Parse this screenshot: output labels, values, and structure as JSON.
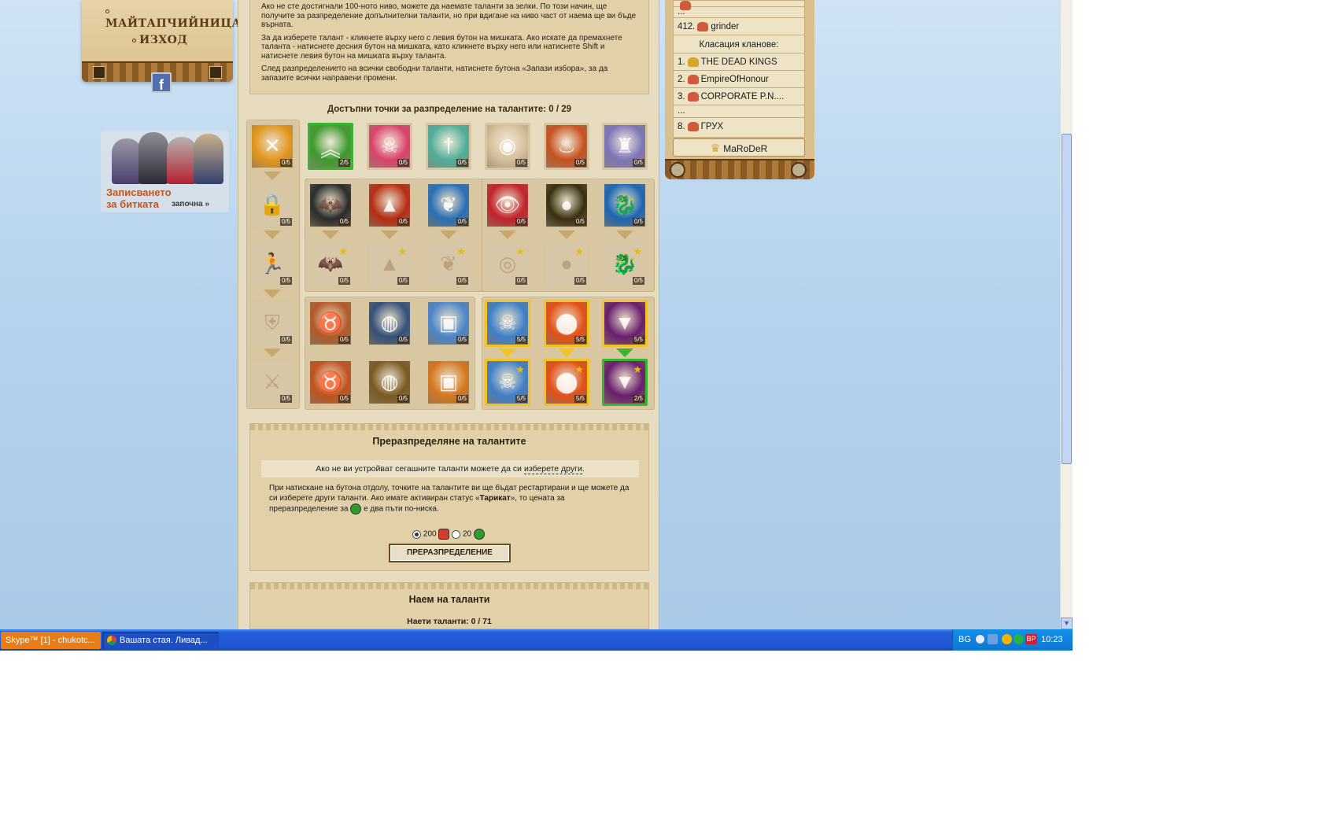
{
  "menu": {
    "item_1": "МАЙТАПЧИЙНИЦА",
    "item_2": "ИЗХОД",
    "facebook_icon": "f"
  },
  "promo": {
    "line_1": "Записването",
    "line_2": "за битката",
    "start": "започна »"
  },
  "info": {
    "p1": "Ако не сте достигнали 100-ното ниво, можете да наемате таланти за зелки. По този начин, ще получите за разпределение допълнителни таланти, но при вдигане на ниво част от наема ще ви бъде върната.",
    "p2": "За да изберете талант - кликнете върху него с левия бутон на мишката. Ако искате да премахнете таланта - натиснете десния бутон на мишката, като кликнете върху него или натиснете Shift и натиснете левия бутон на мишката върху таланта.",
    "p3": "След разпределението на всички свободни таланти, натиснете бутона «Запази избора», за да запазите всички направени промени."
  },
  "points_label": "Достъпни точки за разпределение на талантите: 0 / 29",
  "talents": {
    "row1": [
      {
        "lvl": "0/5",
        "icon": "crossed-swords",
        "color": "#e3961c",
        "glyph": "✕",
        "state": "normal"
      },
      {
        "lvl": "2/5",
        "icon": "rank-chevrons",
        "color": "#3f9a2f",
        "glyph": "︽",
        "state": "green"
      },
      {
        "lvl": "0/5",
        "icon": "skull",
        "color": "#d9436b",
        "glyph": "☠",
        "state": "normal"
      },
      {
        "lvl": "0/5",
        "icon": "sword-scroll",
        "color": "#4fae9a",
        "glyph": "†",
        "state": "normal"
      },
      {
        "lvl": "0/5",
        "icon": "medal-scroll",
        "color": "#d7c09a",
        "glyph": "◉",
        "state": "normal"
      },
      {
        "lvl": "0/5",
        "icon": "flame-sword",
        "color": "#c7521f",
        "glyph": "♨",
        "state": "normal"
      },
      {
        "lvl": "0/5",
        "icon": "knight",
        "color": "#7d74b8",
        "glyph": "♜",
        "state": "normal"
      }
    ],
    "row2": [
      {
        "lvl": "0/5",
        "icon": "padlock",
        "color": "#d7c7a6",
        "glyph": "🔒",
        "state": "locked"
      },
      {
        "lvl": "0/5",
        "icon": "bat",
        "color": "#2b2b2b",
        "glyph": "🦇",
        "state": "normal"
      },
      {
        "lvl": "0/5",
        "icon": "monster-jaw",
        "color": "#b52d14",
        "glyph": "▲",
        "state": "normal"
      },
      {
        "lvl": "0/5",
        "icon": "heart-vines",
        "color": "#2a6fb6",
        "glyph": "❦",
        "state": "normal"
      },
      {
        "lvl": "0/5",
        "icon": "red-demon",
        "color": "#c2232c",
        "glyph": "👁",
        "state": "normal"
      },
      {
        "lvl": "0/5",
        "icon": "dark-orb",
        "color": "#3a3010",
        "glyph": "●",
        "state": "normal"
      },
      {
        "lvl": "0/5",
        "icon": "dragon",
        "color": "#1e66b3",
        "glyph": "🐉",
        "state": "normal"
      }
    ],
    "row3": [
      {
        "lvl": "0/5",
        "icon": "runner",
        "glyph": "🏃",
        "state": "locked"
      },
      {
        "lvl": "0/5",
        "icon": "bat",
        "glyph": "🦇",
        "state": "locked",
        "star": "★"
      },
      {
        "lvl": "0/5",
        "icon": "monster-jaw",
        "glyph": "▲",
        "state": "locked",
        "star": "★"
      },
      {
        "lvl": "0/5",
        "icon": "heart-vines",
        "glyph": "❦",
        "state": "locked",
        "star": "★"
      },
      {
        "lvl": "0/5",
        "icon": "demon",
        "glyph": "◎",
        "state": "locked",
        "star": "★"
      },
      {
        "lvl": "0/5",
        "icon": "orb",
        "glyph": "●",
        "state": "locked",
        "star": "★"
      },
      {
        "lvl": "0/5",
        "icon": "dragon",
        "glyph": "🐉",
        "state": "locked",
        "star": "★"
      }
    ],
    "row4": [
      {
        "lvl": "0/5",
        "icon": "shield",
        "glyph": "⛨",
        "state": "locked"
      },
      {
        "lvl": "0/5",
        "icon": "bull-head",
        "color": "#b35a2a",
        "glyph": "♉",
        "state": "normal"
      },
      {
        "lvl": "0/5",
        "icon": "green-orb-shield",
        "color": "#35507a",
        "glyph": "◍",
        "state": "normal"
      },
      {
        "lvl": "0/5",
        "icon": "winged-scroll",
        "color": "#4b86c9",
        "glyph": "▣",
        "state": "normal"
      },
      {
        "lvl": "5/5",
        "icon": "skull-jar",
        "color": "#3f7fc8",
        "glyph": "☠",
        "state": "active"
      },
      {
        "lvl": "5/5",
        "icon": "red-potion",
        "color": "#e25018",
        "glyph": "⬤",
        "state": "active"
      },
      {
        "lvl": "5/5",
        "icon": "fangs",
        "color": "#6a1e6e",
        "glyph": "▼",
        "state": "active"
      }
    ],
    "row5": [
      {
        "lvl": "0/5",
        "icon": "dagger",
        "glyph": "⚔",
        "state": "locked"
      },
      {
        "lvl": "0/5",
        "icon": "bull-head",
        "color": "#c0521f",
        "glyph": "♉",
        "state": "normal"
      },
      {
        "lvl": "0/5",
        "icon": "green-orb-shield",
        "color": "#7a5a24",
        "glyph": "◍",
        "state": "normal"
      },
      {
        "lvl": "0/5",
        "icon": "winged-scroll",
        "color": "#d6771f",
        "glyph": "▣",
        "state": "normal"
      },
      {
        "lvl": "5/5",
        "icon": "skull-jar",
        "color": "#3f7fc8",
        "glyph": "☠",
        "state": "active",
        "star": "★"
      },
      {
        "lvl": "5/5",
        "icon": "red-potion",
        "color": "#e25018",
        "glyph": "⬤",
        "state": "active",
        "star": "★"
      },
      {
        "lvl": "2/5",
        "icon": "fangs",
        "color": "#6a1e6e",
        "glyph": "▼",
        "state": "green",
        "star": "★"
      }
    ]
  },
  "redistribute": {
    "title": "Преразпределяне на талантите",
    "line_before": "Ако не ви устройват сегашните таланти можете да си ",
    "line_link": "изберете други",
    "line_after": ".",
    "desc_1": "При натискане на бутона отдолу, точките на талантите ви ще бъдат рестартирани и ще можете да си изберете други таланти. Ако имате активиран статус «",
    "desc_bold": "Тарикат",
    "desc_2": "», то цената за преразпределение за",
    "desc_3": "е два пъти по-ниска.",
    "option_1": "200",
    "option_2": "20",
    "button": "ПРЕРАЗПРЕДЕЛЕНИЕ"
  },
  "rent": {
    "title": "Наем на таланти",
    "count": "Наети таланти: 0 / 71"
  },
  "ranking": {
    "dots_1": "...",
    "row_1_num": "412.",
    "row_1_name": "grinder",
    "clans_label": "Класация кланове:",
    "clans": [
      {
        "num": "1.",
        "name": "THE DEAD KINGS",
        "icon": "gold"
      },
      {
        "num": "2.",
        "name": "EmpireOfHonour",
        "icon": "red"
      },
      {
        "num": "3.",
        "name": "CORPORATE P.N....",
        "icon": "red"
      }
    ],
    "dots_2": "...",
    "row_last_num": "8.",
    "row_last_name": "ГРУХ",
    "me": "MaRoDeR"
  },
  "taskbar": {
    "task_1": "Skype™ [1] - chukotc...",
    "task_2": "Вашата стая. Ливад...",
    "lang": "BG",
    "clock": "10:23",
    "tray_bp": "BP"
  }
}
